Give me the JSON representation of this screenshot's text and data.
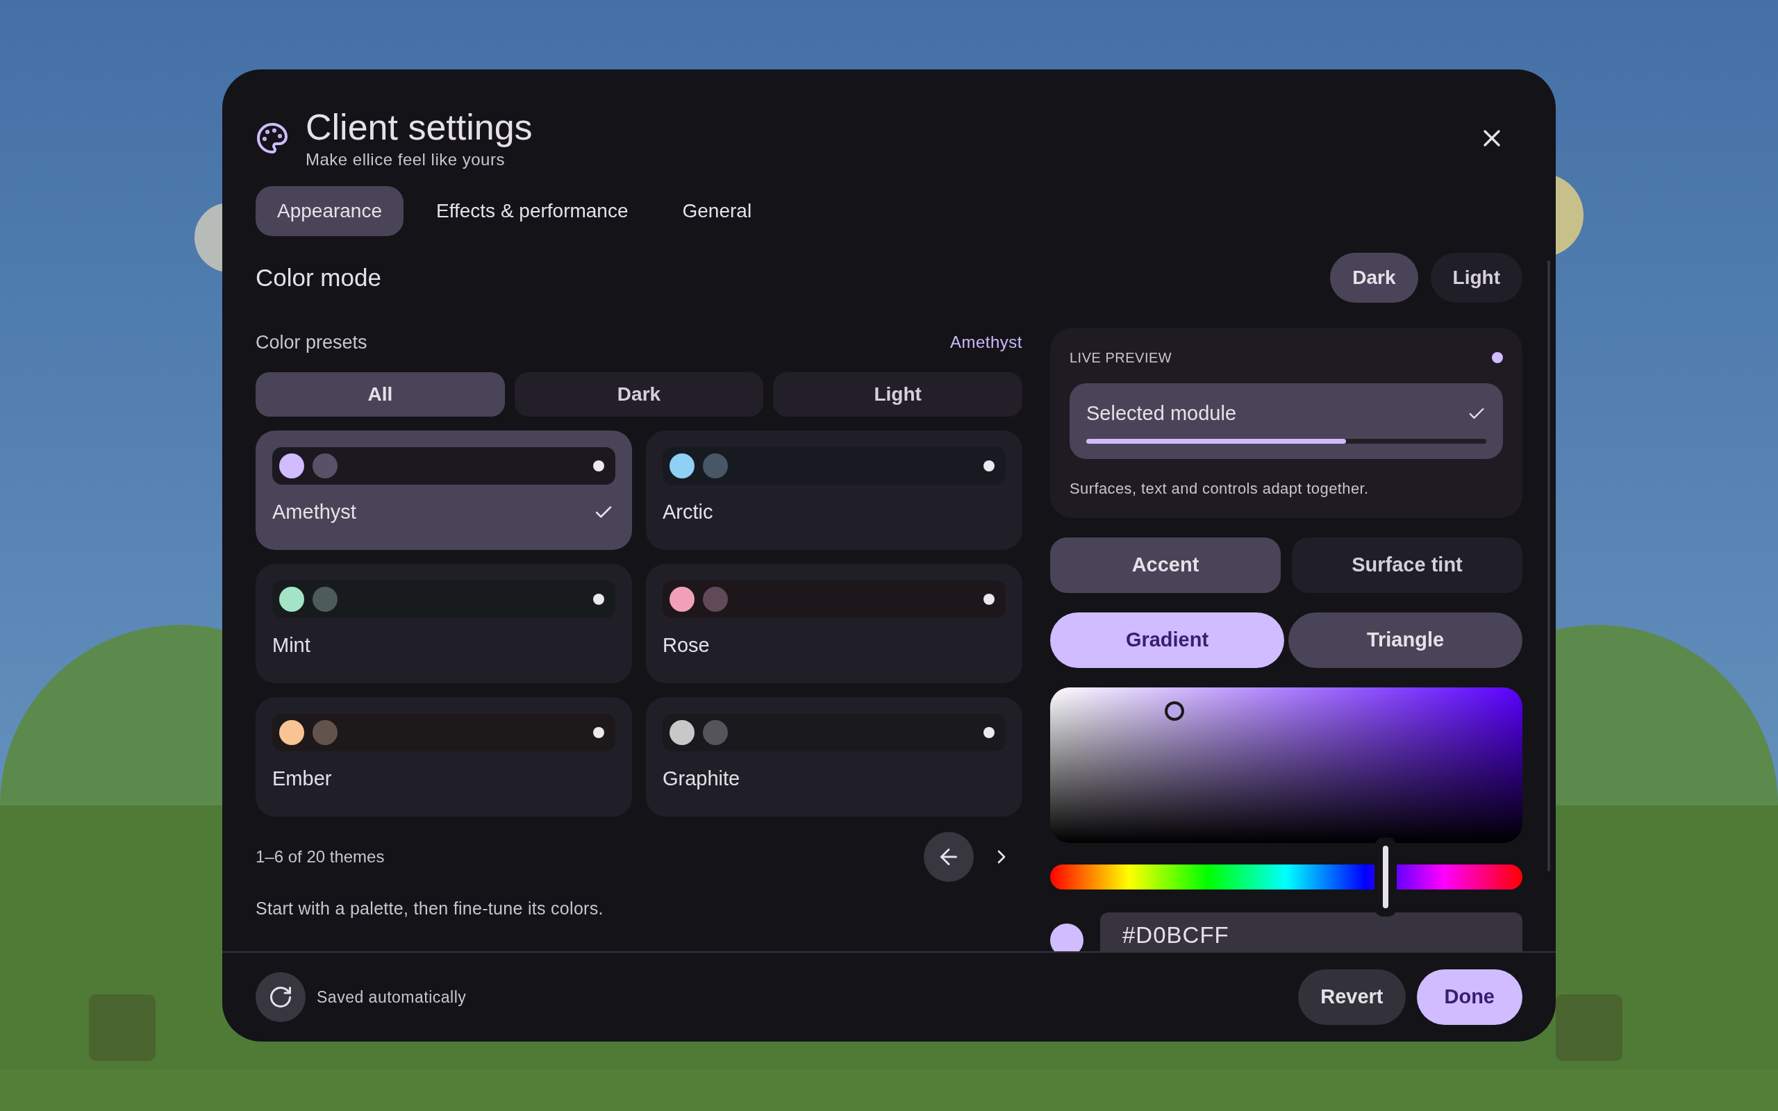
{
  "dialog": {
    "title": "Client settings",
    "subtitle": "Make ellice feel like yours"
  },
  "tabs": [
    {
      "label": "Appearance",
      "selected": true
    },
    {
      "label": "Effects & performance",
      "selected": false
    },
    {
      "label": "General",
      "selected": false
    }
  ],
  "color_mode": {
    "label": "Color mode",
    "options": [
      {
        "label": "Dark",
        "selected": true
      },
      {
        "label": "Light",
        "selected": false
      }
    ]
  },
  "presets": {
    "label": "Color presets",
    "current": "Amethyst",
    "filters": [
      {
        "label": "All",
        "selected": true
      },
      {
        "label": "Dark",
        "selected": false
      },
      {
        "label": "Light",
        "selected": false
      }
    ],
    "themes": [
      {
        "name": "Amethyst",
        "selected": true,
        "color": "#d0bcff"
      },
      {
        "name": "Arctic",
        "selected": false,
        "color": "#8fd0f5"
      },
      {
        "name": "Mint",
        "selected": false,
        "color": "#a3e4c7"
      },
      {
        "name": "Rose",
        "selected": false,
        "color": "#f2a0b8"
      },
      {
        "name": "Ember",
        "selected": false,
        "color": "#f8c493"
      },
      {
        "name": "Graphite",
        "selected": false,
        "color": "#c8c8c8"
      }
    ],
    "pager": "1–6 of 20 themes",
    "hint": "Start with a palette, then fine-tune its colors."
  },
  "preview": {
    "label": "LIVE PREVIEW",
    "module": "Selected module",
    "level": 0.65,
    "note": "Surfaces, text and controls adapt together."
  },
  "targets": [
    {
      "label": "Accent",
      "selected": true
    },
    {
      "label": "Surface tint",
      "selected": false
    }
  ],
  "picker_modes": [
    {
      "label": "Gradient",
      "selected": true
    },
    {
      "label": "Triangle",
      "selected": false
    }
  ],
  "hue": {
    "level": 0.71
  },
  "hex": {
    "value": "#D0BCFF",
    "color": "#d0bcff"
  },
  "footer": {
    "status": "Saved automatically",
    "buttons": [
      {
        "label": "Revert",
        "kind": "secondary"
      },
      {
        "label": "Done",
        "kind": "primary"
      }
    ]
  }
}
